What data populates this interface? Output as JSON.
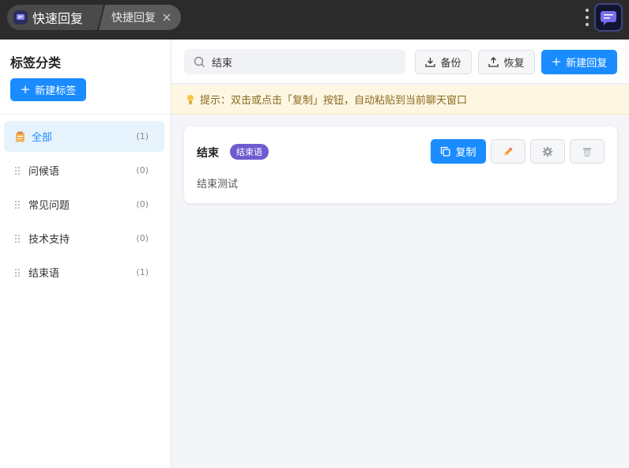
{
  "topbar": {
    "app_title": "快速回复",
    "sub_tab": "快捷回复"
  },
  "sidebar": {
    "title": "标签分类",
    "new_tag_label": "新建标签",
    "categories": [
      {
        "label": "全部",
        "count": "(1)",
        "icon": "clipboard-icon",
        "active": true
      },
      {
        "label": "问候语",
        "count": "(0)",
        "icon": "drag-handle-icon",
        "active": false
      },
      {
        "label": "常见问题",
        "count": "(0)",
        "icon": "drag-handle-icon",
        "active": false
      },
      {
        "label": "技术支持",
        "count": "(0)",
        "icon": "drag-handle-icon",
        "active": false
      },
      {
        "label": "结束语",
        "count": "(1)",
        "icon": "drag-handle-icon",
        "active": false
      }
    ]
  },
  "toolbar": {
    "search_value": "结束",
    "backup_label": "备份",
    "restore_label": "恢复",
    "new_reply_label": "新建回复"
  },
  "tip": {
    "text": "提示：双击或点击「复制」按钮，自动粘贴到当前聊天窗口"
  },
  "replies": [
    {
      "title": "结束",
      "tag": "结束语",
      "content": "结束测试",
      "copy_label": "复制"
    }
  ],
  "colors": {
    "accent": "#1a8cff",
    "tag_badge": "#6d5ccf",
    "tip_bg": "#fdf6e3",
    "topbar_bg": "#2b2b2b"
  }
}
